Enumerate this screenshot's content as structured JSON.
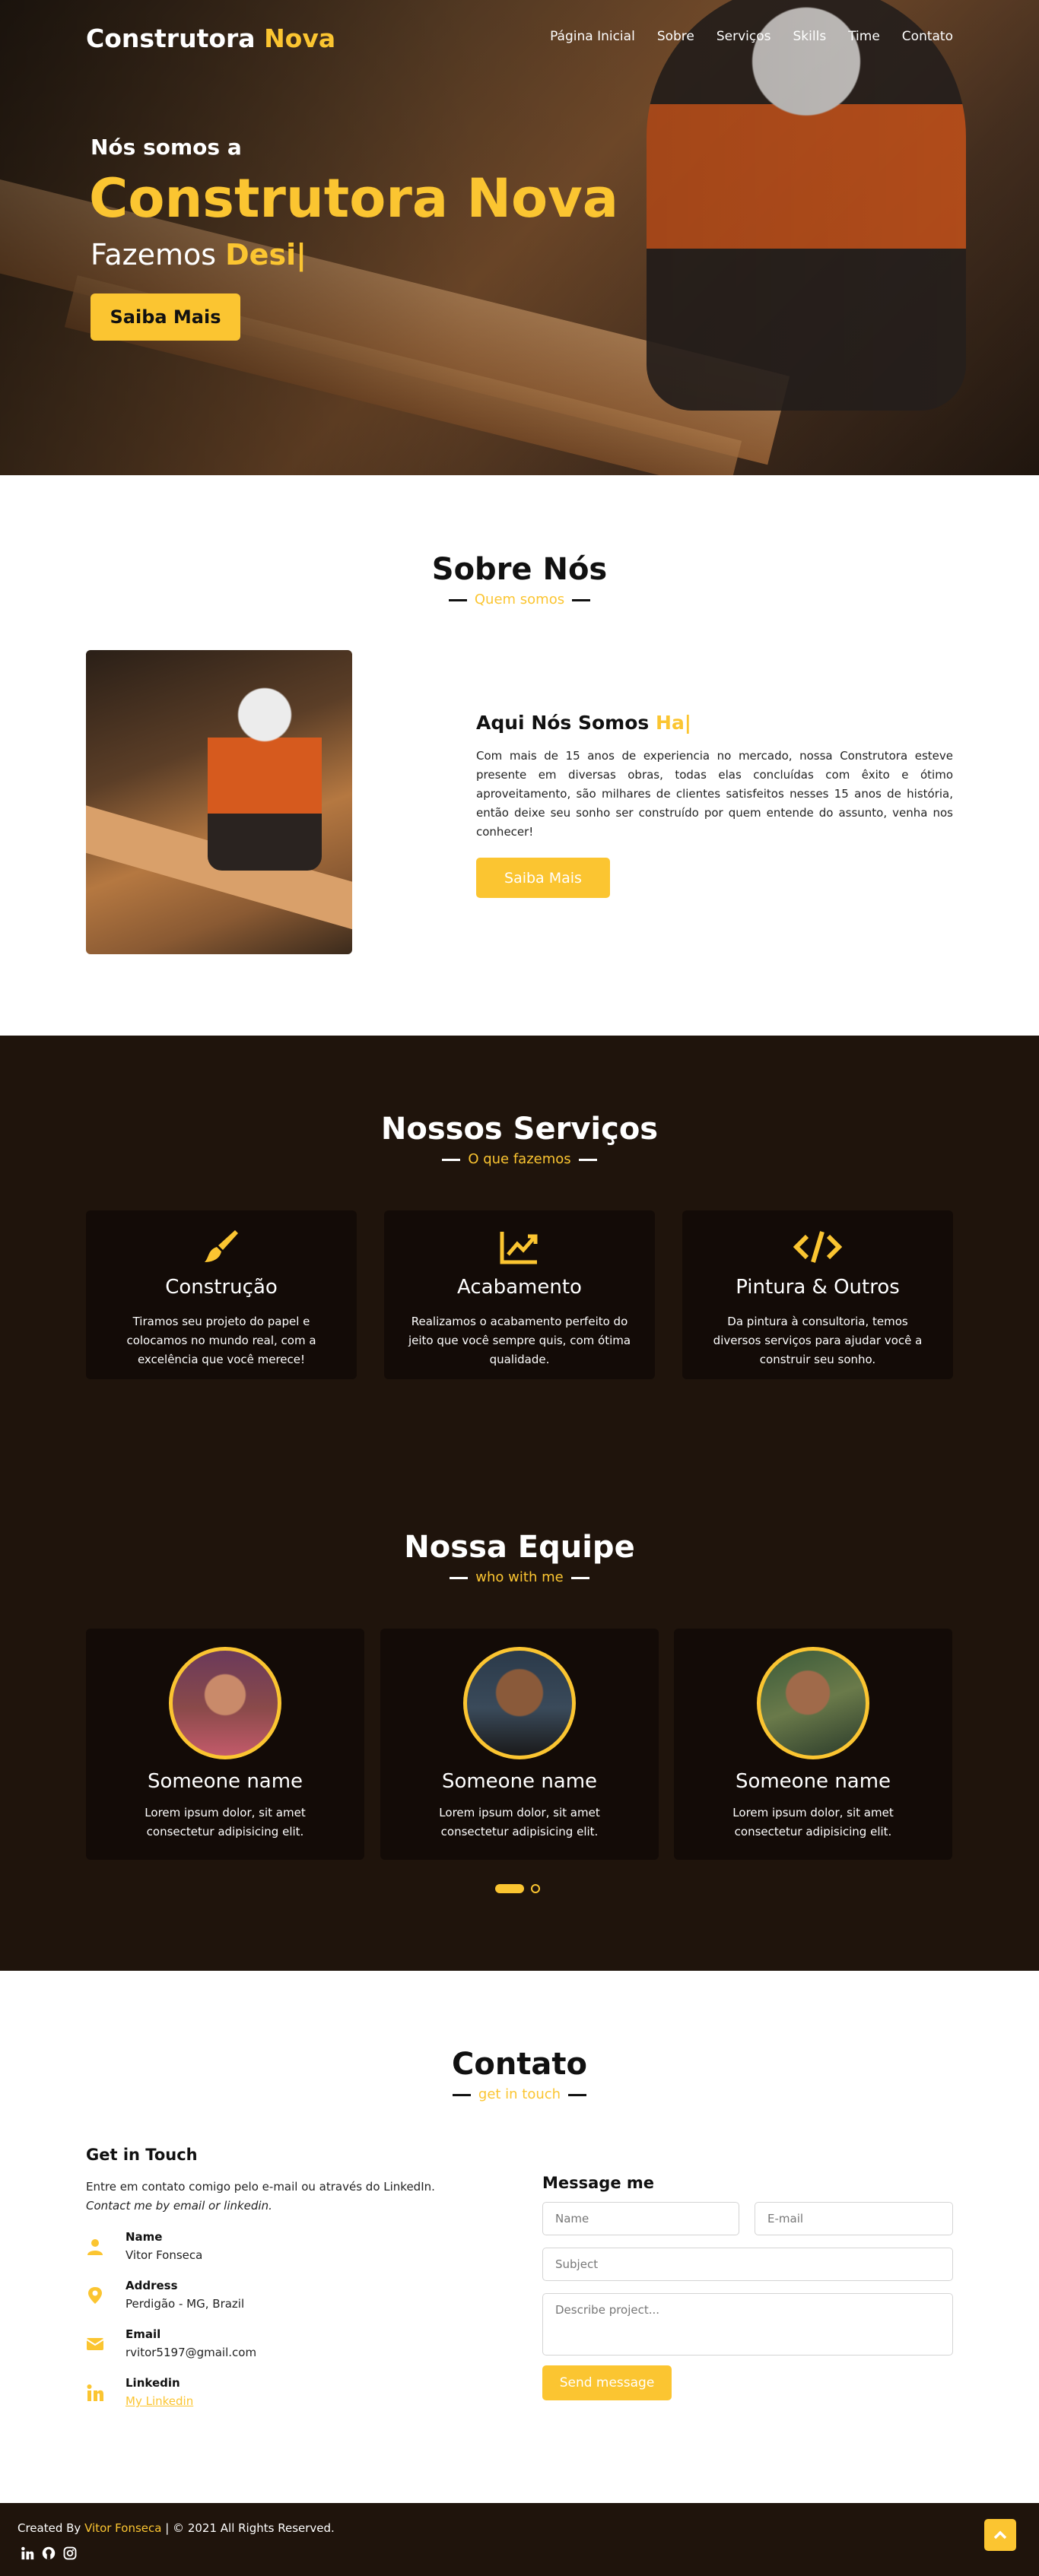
{
  "nav": {
    "brand_main": "Construtora",
    "brand_accent": "Nova",
    "items": [
      "Página Inicial",
      "Sobre",
      "Serviços",
      "Skills",
      "Time",
      "Contato"
    ]
  },
  "hero": {
    "subtitle": "Nós somos a",
    "title": "Construtora Nova",
    "typed_prefix": "Fazemos",
    "typed_word": "Desi|",
    "button": "Saiba Mais"
  },
  "about": {
    "title": "Sobre Nós",
    "subtitle": "Quem somos",
    "heading": "Aqui Nós Somos",
    "heading_accent": "Ha|",
    "text": "Com mais de 15 anos de experiencia no mercado, nossa Construtora esteve presente em diversas obras, todas elas concluídas com êxito e ótimo aproveitamento, são milhares de clientes satisfeitos nesses 15 anos de história, então deixe seu sonho ser construído por quem entende do assunto, venha nos conhecer!",
    "button": "Saiba Mais"
  },
  "services": {
    "title": "Nossos Serviços",
    "subtitle": "O que fazemos",
    "cards": [
      {
        "icon": "paint-brush-icon",
        "title": "Construção",
        "text": "Tiramos seu projeto do papel e colocamos no mundo real, com a excelência que você merece!"
      },
      {
        "icon": "chart-line-icon",
        "title": "Acabamento",
        "text": "Realizamos o acabamento perfeito do jeito que você sempre quis, com ótima qualidade."
      },
      {
        "icon": "code-icon",
        "title": "Pintura & Outros",
        "text": "Da pintura à consultoria, temos diversos serviços para ajudar você a construir seu sonho."
      }
    ]
  },
  "team": {
    "title": "Nossa Equipe",
    "subtitle": "who with me",
    "members": [
      {
        "name": "Someone name",
        "text": "Lorem ipsum dolor, sit amet consectetur adipisicing elit."
      },
      {
        "name": "Someone name",
        "text": "Lorem ipsum dolor, sit amet consectetur adipisicing elit."
      },
      {
        "name": "Someone name",
        "text": "Lorem ipsum dolor, sit amet consectetur adipisicing elit."
      }
    ]
  },
  "contact": {
    "title": "Contato",
    "subtitle": "get in touch",
    "heading": "Get in Touch",
    "intro": "Entre em contato comigo pelo e-mail ou através do LinkedIn.",
    "intro_em": "Contact me by email or linkedin.",
    "info": [
      {
        "icon": "user-icon",
        "label": "Name",
        "value": "Vitor Fonseca"
      },
      {
        "icon": "map-marker-icon",
        "label": "Address",
        "value": "Perdigão - MG, Brazil"
      },
      {
        "icon": "envelope-icon",
        "label": "Email",
        "value": "rvitor5197@gmail.com"
      },
      {
        "icon": "linkedin-icon",
        "label": "Linkedin",
        "value": "My Linkedin"
      }
    ],
    "form_title": "Message me",
    "placeholders": {
      "name": "Name",
      "email": "E-mail",
      "subject": "Subject",
      "message": "Describe project..."
    },
    "send": "Send message"
  },
  "footer": {
    "created_by": "Created By",
    "author": "Vitor Fonseca",
    "rights": "| © 2021 All Rights Reserved.",
    "icons": [
      "linkedin-icon",
      "github-icon",
      "instagram-icon"
    ]
  },
  "colors": {
    "accent": "#fbc531",
    "dark": "#1f140c",
    "card": "#130b07"
  }
}
